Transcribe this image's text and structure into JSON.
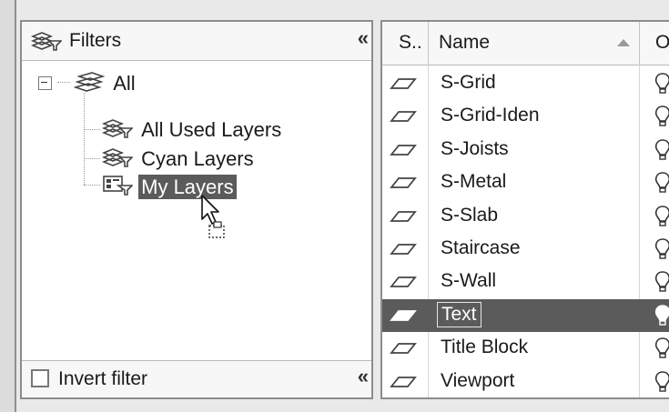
{
  "filters_panel": {
    "title": "Filters",
    "collapse_glyph": "«",
    "tree": {
      "root": {
        "label": "All",
        "expander": "⊟"
      },
      "children": [
        {
          "label": "All Used Layers",
          "icon": "filter-icon"
        },
        {
          "label": "Cyan Layers",
          "icon": "filter-icon"
        },
        {
          "label": "My Layers",
          "icon": "group-filter-icon",
          "selected": true
        }
      ]
    },
    "footer": {
      "checkbox_label": "Invert filter",
      "checked": false,
      "collapse_glyph": "«"
    }
  },
  "layer_list": {
    "columns": {
      "status": "S..",
      "name": "Name",
      "on": "O"
    },
    "sort": "ascending",
    "rows": [
      {
        "name": "S-Grid"
      },
      {
        "name": "S-Grid-Iden"
      },
      {
        "name": "S-Joists"
      },
      {
        "name": "S-Metal"
      },
      {
        "name": "S-Slab"
      },
      {
        "name": "Staircase"
      },
      {
        "name": "S-Wall"
      },
      {
        "name": "Text",
        "selected": true
      },
      {
        "name": "Title Block"
      },
      {
        "name": "Viewport"
      }
    ]
  },
  "colors": {
    "selection": "#5b5b5b",
    "panel_bg": "#ffffff",
    "border": "#8c8c8c"
  }
}
